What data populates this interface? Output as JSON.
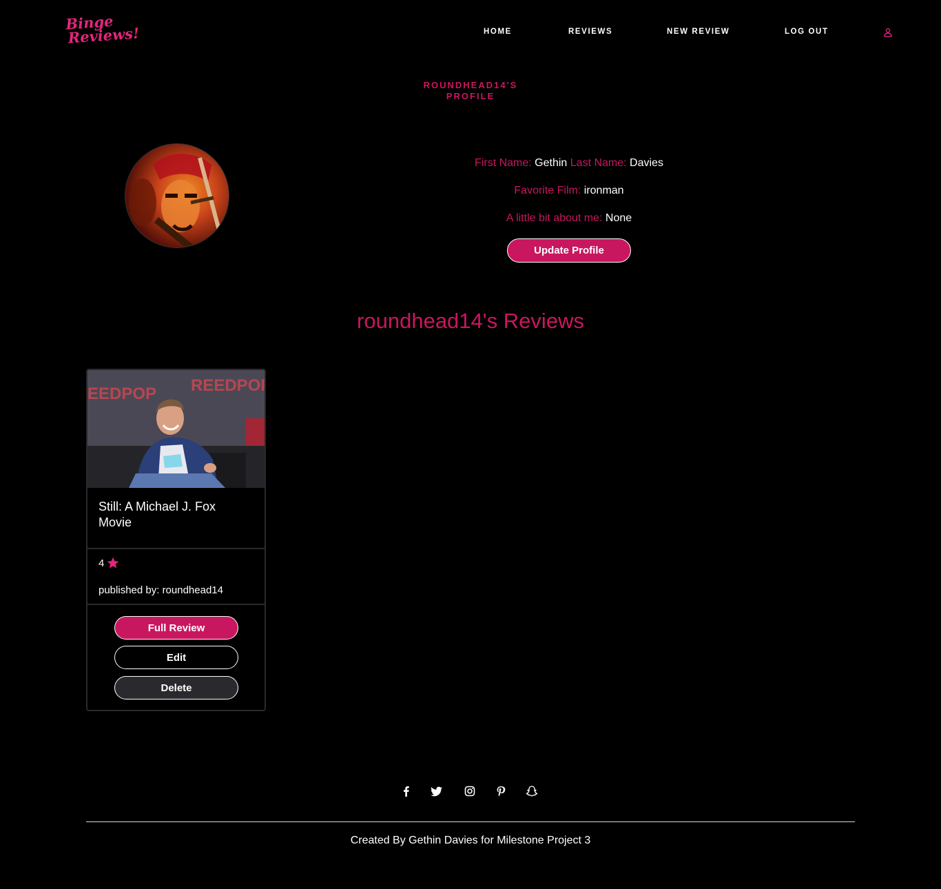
{
  "brand": {
    "logo_line1": "Binge",
    "logo_line2": "Reviews!",
    "accent_color": "#c8175f"
  },
  "nav": {
    "items": [
      {
        "label": "HOME"
      },
      {
        "label": "REVIEWS"
      },
      {
        "label": "NEW REVIEW"
      },
      {
        "label": "LOG OUT"
      }
    ],
    "profile_icon": "user-icon"
  },
  "profile": {
    "heading": "ROUNDHEAD14'S PROFILE",
    "first_name_label": "First Name:",
    "first_name": "Gethin",
    "last_name_label": "Last Name:",
    "last_name": "Davies",
    "favorite_film_label": "Favorite Film:",
    "favorite_film": "ironman",
    "about_label": "A little bit about me:",
    "about": "None",
    "update_button": "Update Profile"
  },
  "reviews": {
    "heading": "roundhead14's Reviews",
    "items": [
      {
        "title": "Still: A Michael J. Fox Movie",
        "rating": "4",
        "published_by": "published by: roundhead14",
        "full_review_button": "Full Review",
        "edit_button": "Edit",
        "delete_button": "Delete"
      }
    ]
  },
  "footer": {
    "social_icons": [
      "facebook-icon",
      "twitter-icon",
      "instagram-icon",
      "pinterest-icon",
      "snapchat-icon"
    ],
    "credit": "Created By Gethin Davies for Milestone Project 3"
  }
}
